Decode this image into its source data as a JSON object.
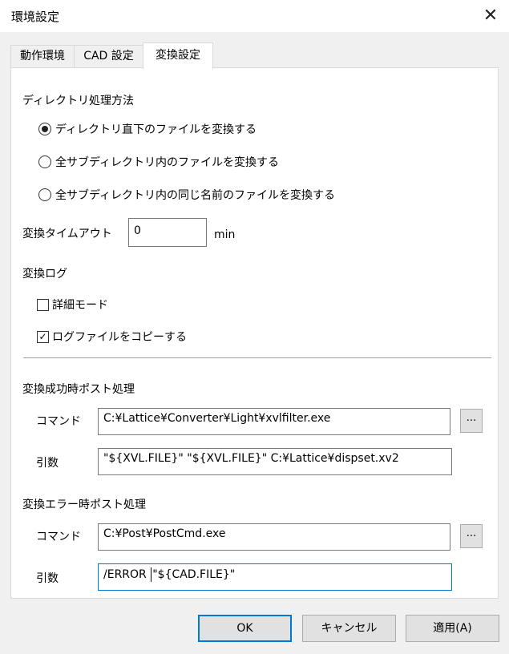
{
  "window": {
    "title": "環境設定",
    "close_symbol": "✕"
  },
  "tabs": [
    {
      "label": "動作環境",
      "active": false
    },
    {
      "label": "CAD 設定",
      "active": false
    },
    {
      "label": "変換設定",
      "active": true
    }
  ],
  "directory": {
    "heading": "ディレクトリ処理方法",
    "options": [
      {
        "label": "ディレクトリ直下のファイルを変換する",
        "selected": true
      },
      {
        "label": "全サブディレクトリ内のファイルを変換する",
        "selected": false
      },
      {
        "label": "全サブディレクトリ内の同じ名前のファイルを変換する",
        "selected": false
      }
    ]
  },
  "timeout": {
    "label": "変換タイムアウト",
    "value": "0",
    "unit": "min"
  },
  "log": {
    "heading": "変換ログ",
    "detail_mode": {
      "label": "詳細モード",
      "checked": false
    },
    "copy_logfile": {
      "label": "ログファイルをコピーする",
      "checked": true
    }
  },
  "success_post": {
    "heading": "変換成功時ポスト処理",
    "command_label": "コマンド",
    "command_value": "C:¥Lattice¥Converter¥Light¥xvlfilter.exe",
    "args_label": "引数",
    "args_value": "\"${XVL.FILE}\" \"${XVL.FILE}\" C:¥Lattice¥dispset.xv2",
    "browse_label": "..."
  },
  "error_post": {
    "heading": "変換エラー時ポスト処理",
    "command_label": "コマンド",
    "command_value": "C:¥Post¥PostCmd.exe",
    "args_label": "引数",
    "args_value_before_caret": "/ERROR ",
    "args_value_after_caret": "\"${CAD.FILE}\"",
    "browse_label": "..."
  },
  "buttons": {
    "ok": "OK",
    "cancel": "キャンセル",
    "apply": "適用(A)"
  }
}
